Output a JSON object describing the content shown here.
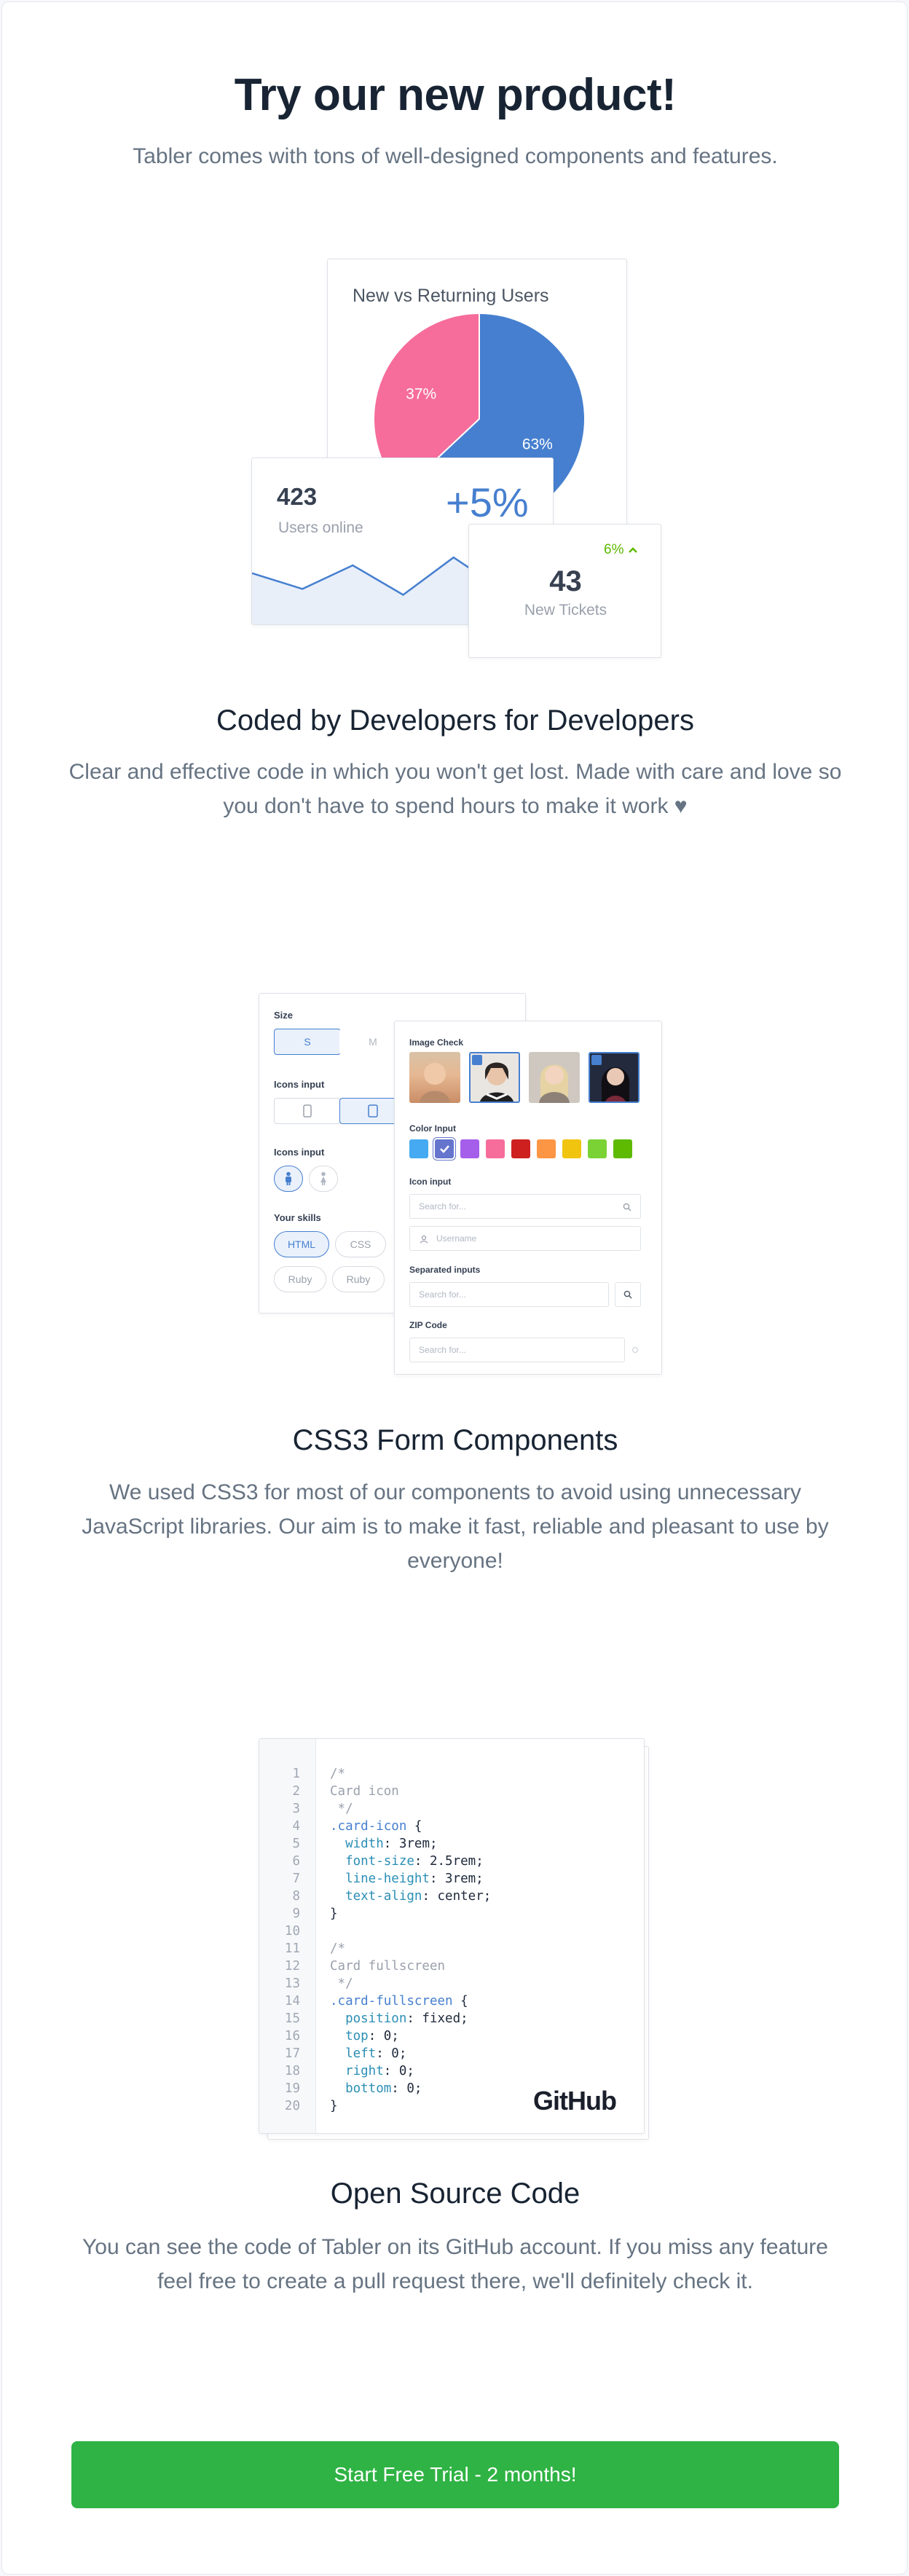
{
  "hero": {
    "title": "Try our new product!",
    "subtitle": "Tabler comes with tons of well-designed components and features."
  },
  "dashboard_illustration": {
    "pie_card_title": "New vs Returning Users",
    "pie": {
      "slices": [
        {
          "label": "37%",
          "value": 37,
          "color": "#f66d9b"
        },
        {
          "label": "63%",
          "value": 63,
          "color": "#467fcf"
        }
      ]
    },
    "users_card": {
      "value": "423",
      "label": "Users online",
      "change": "+5%",
      "sparkline": [
        52,
        36,
        60,
        30,
        68,
        34,
        56
      ]
    },
    "tickets_card": {
      "value": "43",
      "label": "New Tickets",
      "change": "6%"
    }
  },
  "section1": {
    "title": "Coded by Developers for Developers",
    "text": "Clear and effective code in which you won't get lost. Made with care and love so you don't have to spend hours to make it work ♥"
  },
  "form_illustration": {
    "size_label": "Size",
    "size_options": [
      "S",
      "M"
    ],
    "icons_input_label": "Icons input",
    "icons_input2_label": "Icons input",
    "skills_label": "Your skills",
    "skills": [
      "HTML",
      "CSS",
      "Ruby",
      "Ruby"
    ],
    "image_check_label": "Image Check",
    "color_input_label": "Color Input",
    "colors": [
      "#45aaf2",
      "#6574cd",
      "#a55eea",
      "#f66d9b",
      "#cd201f",
      "#fd9644",
      "#f1c40f",
      "#7bd235",
      "#5eba00"
    ],
    "icon_input_label": "Icon input",
    "search_placeholder": "Search for...",
    "username_placeholder": "Username",
    "separated_inputs_label": "Separated inputs",
    "separated_placeholder": "Search for...",
    "zip_label": "ZIP Code",
    "zip_placeholder": "Search for..."
  },
  "section2": {
    "title": "CSS3 Form Components",
    "text": "We used CSS3 for most of our components to avoid using unnecessary JavaScript libraries. Our aim is to make it fast, reliable and pleasant to use by everyone!"
  },
  "code_illustration": {
    "line_numbers": [
      "1",
      "2",
      "3",
      "4",
      "5",
      "6",
      "7",
      "8",
      "9",
      "10",
      "11",
      "12",
      "13",
      "14",
      "15",
      "16",
      "17",
      "18",
      "19",
      "20"
    ],
    "brand": "GitHub",
    "lines": [
      [
        [
          "c-com",
          "/*"
        ]
      ],
      [
        [
          "c-com",
          "Card icon"
        ]
      ],
      [
        [
          "c-com",
          " */"
        ]
      ],
      [
        [
          "c-sel",
          ".card-icon"
        ],
        [
          "c-val",
          " {"
        ]
      ],
      [
        [
          "c-prop",
          "  width"
        ],
        [
          "c-val",
          ": 3rem;"
        ]
      ],
      [
        [
          "c-prop",
          "  font-size"
        ],
        [
          "c-val",
          ": 2.5rem;"
        ]
      ],
      [
        [
          "c-prop",
          "  line-height"
        ],
        [
          "c-val",
          ": 3rem;"
        ]
      ],
      [
        [
          "c-prop",
          "  text-align"
        ],
        [
          "c-val",
          ": center;"
        ]
      ],
      [
        [
          "c-val",
          "}"
        ]
      ],
      [
        [
          "c-val",
          ""
        ]
      ],
      [
        [
          "c-com",
          "/*"
        ]
      ],
      [
        [
          "c-com",
          "Card fullscreen"
        ]
      ],
      [
        [
          "c-com",
          " */"
        ]
      ],
      [
        [
          "c-sel",
          ".card-fullscreen"
        ],
        [
          "c-val",
          " {"
        ]
      ],
      [
        [
          "c-prop",
          "  position"
        ],
        [
          "c-val",
          ": fixed;"
        ]
      ],
      [
        [
          "c-prop",
          "  top"
        ],
        [
          "c-val",
          ": 0;"
        ]
      ],
      [
        [
          "c-prop",
          "  left"
        ],
        [
          "c-val",
          ": 0;"
        ]
      ],
      [
        [
          "c-prop",
          "  right"
        ],
        [
          "c-val",
          ": 0;"
        ]
      ],
      [
        [
          "c-prop",
          "  bottom"
        ],
        [
          "c-val",
          ": 0;"
        ]
      ],
      [
        [
          "c-val",
          "}"
        ]
      ]
    ]
  },
  "section3": {
    "title": "Open Source Code",
    "text": "You can see the code of Tabler on its GitHub account. If you miss any feature feel free to create a pull request there, we'll definitely check it."
  },
  "cta": {
    "label": "Start Free Trial - 2 months!"
  }
}
